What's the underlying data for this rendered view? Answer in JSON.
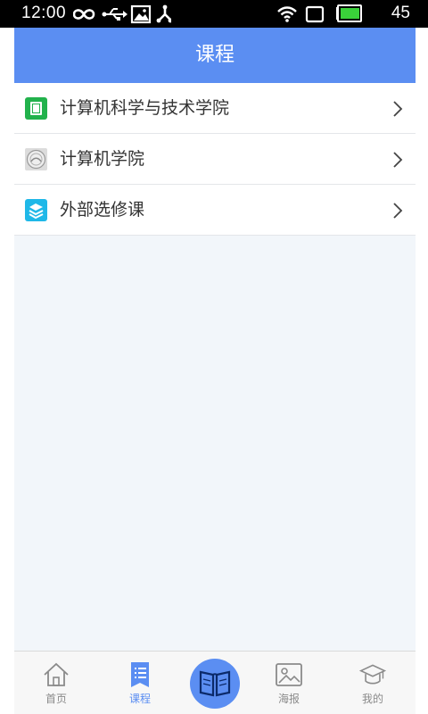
{
  "status_bar": {
    "time": "12:00",
    "battery_level": "45",
    "icons_left": [
      "infinity-icon",
      "usb-icon",
      "image-icon",
      "share-icon"
    ],
    "icons_right": [
      "wifi-icon",
      "sim-icon",
      "battery-icon"
    ]
  },
  "header": {
    "title": "课程"
  },
  "course_list": {
    "items": [
      {
        "label": "计算机科学与技术学院",
        "icon": "green-book-icon"
      },
      {
        "label": "计算机学院",
        "icon": "emblem-icon"
      },
      {
        "label": "外部选修课",
        "icon": "cyan-stack-icon"
      }
    ]
  },
  "bottom_nav": {
    "items": [
      {
        "label": "首页",
        "icon": "home-icon"
      },
      {
        "label": "课程",
        "icon": "list-icon"
      },
      {
        "label": "",
        "icon": "open-book-icon"
      },
      {
        "label": "海报",
        "icon": "picture-icon"
      },
      {
        "label": "我的",
        "icon": "graduation-cap-icon"
      }
    ],
    "active_label": "课程"
  },
  "colors": {
    "accent": "#5b8ef2",
    "page_background": "#f2f6fa",
    "status_bar": "#000000",
    "battery_fill": "#3ad13a"
  }
}
